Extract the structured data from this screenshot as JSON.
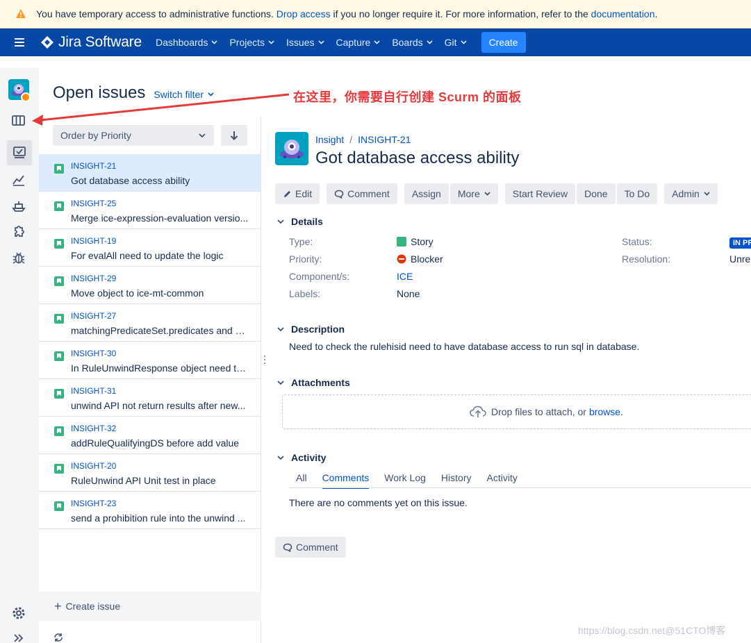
{
  "banner": {
    "text_before": "You have temporary access to administrative functions.",
    "link1": "Drop access",
    "text_middle": "if you no longer require it. For more information, refer to the",
    "link2": "documentation",
    "text_after": "."
  },
  "nav": {
    "product": "Jira Software",
    "items": [
      {
        "label": "Dashboards"
      },
      {
        "label": "Projects"
      },
      {
        "label": "Issues"
      },
      {
        "label": "Capture"
      },
      {
        "label": "Boards"
      },
      {
        "label": "Git"
      }
    ],
    "create_label": "Create"
  },
  "page": {
    "title": "Open issues",
    "switch_filter": "Switch filter"
  },
  "annotation": {
    "text": "在这里，你需要自行创建 Scurm  的面板",
    "color": "#e5393a"
  },
  "list": {
    "order_label": "Order by Priority",
    "issues": [
      {
        "key": "INSIGHT-21",
        "summary": "Got database access ability"
      },
      {
        "key": "INSIGHT-25",
        "summary": "Merge ice-expression-evaluation versio..."
      },
      {
        "key": "INSIGHT-19",
        "summary": "For evalAll need to update the logic"
      },
      {
        "key": "INSIGHT-29",
        "summary": "Move object to ice-mt-common"
      },
      {
        "key": "INSIGHT-27",
        "summary": "matchingPredicateSet.predicates and m..."
      },
      {
        "key": "INSIGHT-30",
        "summary": "In RuleUnwindResponse object need to ..."
      },
      {
        "key": "INSIGHT-31",
        "summary": "unwind API not return results after new..."
      },
      {
        "key": "INSIGHT-32",
        "summary": "addRuleQualifyingDS before add value"
      },
      {
        "key": "INSIGHT-20",
        "summary": "RuleUnwind API Unit test in place"
      },
      {
        "key": "INSIGHT-23",
        "summary": "send a prohibition rule into the unwind ..."
      }
    ],
    "create_issue": "Create issue"
  },
  "detail": {
    "project": "Insight",
    "key": "INSIGHT-21",
    "title": "Got database access ability",
    "actions": {
      "edit": "Edit",
      "comment": "Comment",
      "assign": "Assign",
      "more": "More",
      "start_review": "Start Review",
      "done": "Done",
      "todo": "To Do",
      "admin": "Admin"
    },
    "details_heading": "Details",
    "fields": {
      "type_label": "Type:",
      "type_value": "Story",
      "priority_label": "Priority:",
      "priority_value": "Blocker",
      "component_label": "Component/s:",
      "component_value": "ICE",
      "labels_label": "Labels:",
      "labels_value": "None",
      "status_label": "Status:",
      "status_value": "IN PR",
      "resolution_label": "Resolution:",
      "resolution_value": "Unre"
    },
    "description_heading": "Description",
    "description": "Need to check the rulehisid need to have database access to run sql in database.",
    "attachments_heading": "Attachments",
    "drop_text": "Drop files to attach, or",
    "browse_link": "browse.",
    "activity_heading": "Activity",
    "activity_tabs": [
      "All",
      "Comments",
      "Work Log",
      "History",
      "Activity"
    ],
    "no_comments": "There are no comments yet on this issue.",
    "comment_button": "Comment"
  },
  "watermark": "https://blog.csdn.net@51CTO博客"
}
